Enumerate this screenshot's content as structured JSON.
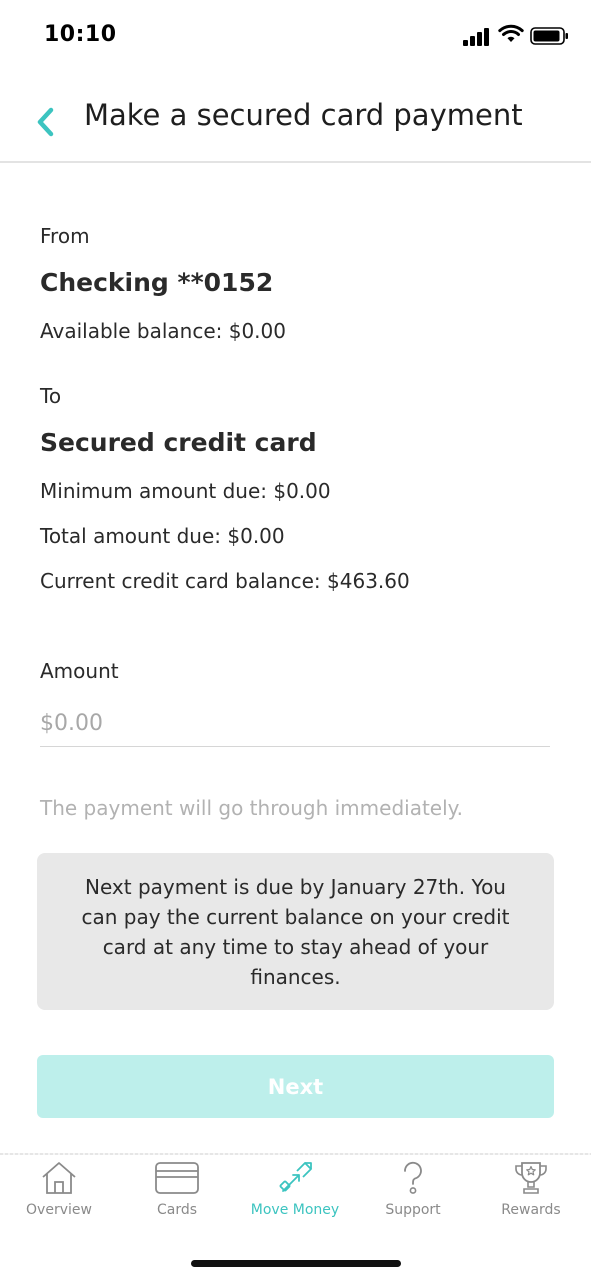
{
  "status_bar": {
    "time": "10:10"
  },
  "header": {
    "title": "Make a secured card payment",
    "back_icon": "chevron-left-icon",
    "accent_color": "#3cc4c0"
  },
  "from": {
    "label": "From",
    "account": "Checking **0152",
    "available_balance": "Available balance: $0.00"
  },
  "to": {
    "label": "To",
    "account": "Secured credit card",
    "minimum_due": "Minimum amount due: $0.00",
    "total_due": "Total amount due: $0.00",
    "current_balance": "Current credit card balance: $463.60"
  },
  "amount": {
    "label": "Amount",
    "value": "",
    "placeholder": "$0.00"
  },
  "hint": "The payment will go through immediately.",
  "notice": "Next payment is due by January 27th. You can pay the current balance on your credit card at any time to stay ahead of your finances.",
  "next_button": {
    "label": "Next",
    "color": "#bdefeb"
  },
  "tab_bar": {
    "tabs": [
      {
        "label": "Overview",
        "icon": "home-icon",
        "active": false
      },
      {
        "label": "Cards",
        "icon": "card-icon",
        "active": false
      },
      {
        "label": "Move Money",
        "icon": "transfer-arrows-icon",
        "active": true
      },
      {
        "label": "Support",
        "icon": "question-icon",
        "active": false
      },
      {
        "label": "Rewards",
        "icon": "trophy-icon",
        "active": false
      }
    ]
  }
}
